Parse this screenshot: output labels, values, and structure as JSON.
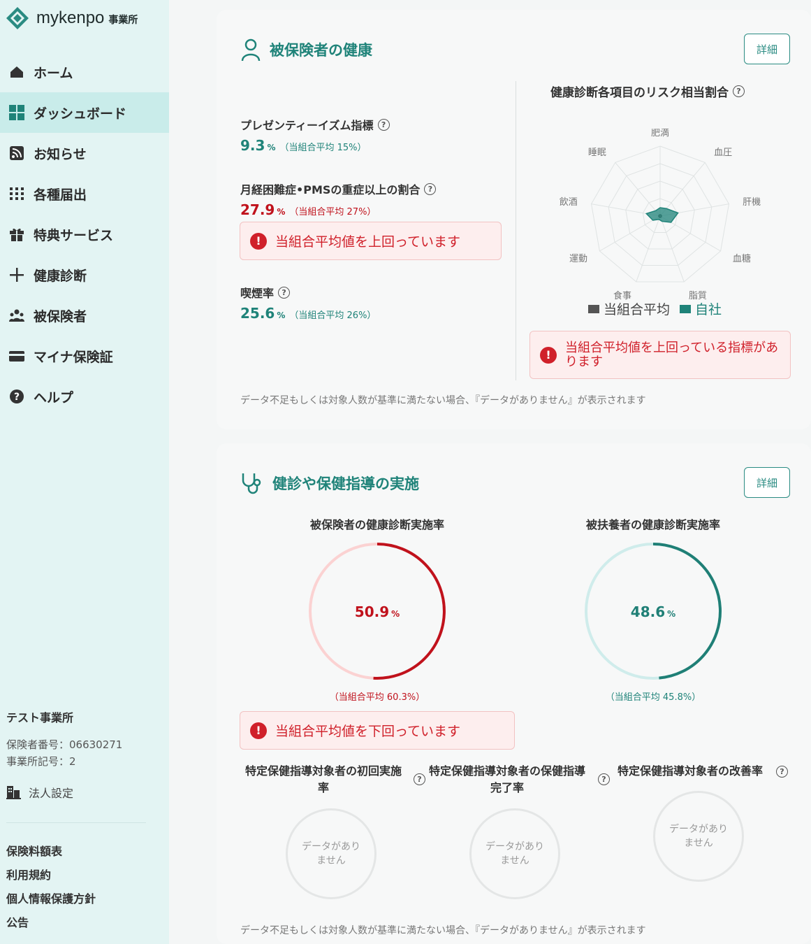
{
  "brand": {
    "name": "mykenpo",
    "sub": "事業所"
  },
  "nav": [
    {
      "label": "ホーム",
      "icon": "home-icon",
      "active": false
    },
    {
      "label": "ダッシュボード",
      "icon": "dashboard-icon",
      "active": true
    },
    {
      "label": "お知らせ",
      "icon": "rss-icon",
      "active": false
    },
    {
      "label": "各種届出",
      "icon": "grid-dots-icon",
      "active": false
    },
    {
      "label": "特典サービス",
      "icon": "gift-icon",
      "active": false
    },
    {
      "label": "健康診断",
      "icon": "plus-icon",
      "active": false
    },
    {
      "label": "被保険者",
      "icon": "people-icon",
      "active": false
    },
    {
      "label": "マイナ保険証",
      "icon": "card-icon",
      "active": false
    },
    {
      "label": "ヘルプ",
      "icon": "help-icon",
      "active": false
    }
  ],
  "org": {
    "name": "テスト事業所",
    "insurer_no": "保険者番号：06630271",
    "office_code": "事業所記号：2",
    "corp_settings": "法人設定"
  },
  "footer_links": [
    "保険料額表",
    "利用規約",
    "個人情報保護方針",
    "公告"
  ],
  "health": {
    "title": "被保険者の健康",
    "detail_label": "詳細",
    "presenteeism": {
      "label": "プレゼンティーイズム指標",
      "value": "9.3",
      "unit": "%",
      "avg": "（当組合平均 15%）"
    },
    "pms": {
      "label": "月経困難症•PMSの重症以上の割合",
      "value": "27.9",
      "unit": "%",
      "avg": "（当組合平均 27%）"
    },
    "pms_alert": "当組合平均値を上回っています",
    "smoking": {
      "label": "喫煙率",
      "value": "25.6",
      "unit": "%",
      "avg": "（当組合平均 26%）"
    },
    "radar_title": "健康診断各項目のリスク相当割合",
    "radar_alert": "当組合平均値を上回っている指標があります",
    "note": "データ不足もしくは対象人数が基準に満たない場合、『データがありません』が表示されます"
  },
  "chart_data": [
    {
      "type": "radar",
      "title": "健康診断各項目のリスク相当割合",
      "categories": [
        "肥満",
        "血圧",
        "肝機能",
        "血糖",
        "脂質",
        "食事",
        "運動",
        "飲酒",
        "睡眠"
      ],
      "range": [
        0,
        1
      ],
      "series": [
        {
          "name": "当組合平均",
          "values": [
            0.02,
            0.02,
            0.02,
            0.02,
            0.02,
            0.02,
            0.02,
            0.02,
            0.02
          ]
        },
        {
          "name": "自社",
          "values": [
            0.12,
            0.14,
            0.26,
            0.18,
            0.08,
            0.05,
            0.12,
            0.2,
            0.1
          ]
        }
      ],
      "legend": [
        "当組合平均",
        "自社"
      ],
      "colors": {
        "当組合平均": "#555555",
        "自社": "#1f8379"
      }
    },
    {
      "type": "donut",
      "title": "被保険者の健康診断実施率",
      "value": 50.9,
      "unit": "%",
      "avg_label": "（当組合平均 60.3%）",
      "color": "#c0121c"
    },
    {
      "type": "donut",
      "title": "被扶養者の健康診断実施率",
      "value": 48.6,
      "unit": "%",
      "avg_label": "（当組合平均 45.8%）",
      "color": "#1f7f76"
    }
  ],
  "checkup": {
    "title": "健診や保健指導の実施",
    "detail_label": "詳細",
    "donut1": {
      "title": "被保険者の健康診断実施率",
      "value": "50.9",
      "unit": "%",
      "avg": "（当組合平均 60.3%）"
    },
    "donut2": {
      "title": "被扶養者の健康診断実施率",
      "value": "48.6",
      "unit": "%",
      "avg": "（当組合平均 45.8%）"
    },
    "alert": "当組合平均値を下回っています",
    "small1": {
      "title_line1": "特定保健指導対象者の初回実施",
      "title_line2": "率",
      "empty": "データがありません"
    },
    "small2": {
      "title_line1": "特定保健指導対象者の保健指導",
      "title_line2": "完了率",
      "empty": "データがありません"
    },
    "small3": {
      "title_line1": "特定保健指導対象者の改善率",
      "empty": "データがありません"
    },
    "note": "データ不足もしくは対象人数が基準に満たない場合、『データがありません』が表示されます"
  },
  "colors": {
    "accent": "#1f8379",
    "alert_red": "#d0202a",
    "sidebar_bg": "#e3f4f3",
    "active_bg": "#c9ecea"
  }
}
